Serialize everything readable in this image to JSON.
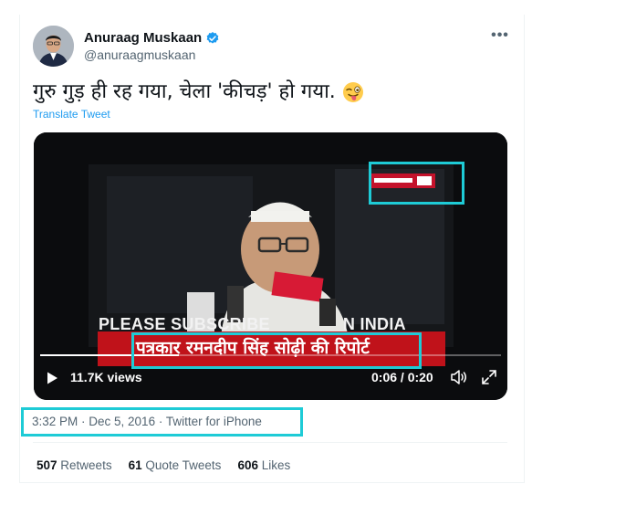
{
  "user": {
    "display_name": "Anuraag Muskaan",
    "handle": "@anuraagmuskaan",
    "verified": true
  },
  "tweet": {
    "text": "गुरु गुड़ ही रह गया, चेला 'कीचड़' हो गया.",
    "emoji": "winking-face-with-tongue",
    "translate_label": "Translate Tweet"
  },
  "video": {
    "overlay_subscribe_left": "PLEASE SUBSCRIBE",
    "overlay_subscribe_right": "N INDIA",
    "report_banner": "पत्रकार रमनदीप सिंह सोढ़ी की रिपोर्ट",
    "views": "11.7K views",
    "time": "0:06 / 0:20",
    "progress": 0.3
  },
  "meta": {
    "timestamp": "3:32 PM · Dec 5, 2016 · Twitter for iPhone"
  },
  "stats": {
    "retweets_count": "507",
    "retweets_label": "Retweets",
    "quotes_count": "61",
    "quotes_label": "Quote Tweets",
    "likes_count": "606",
    "likes_label": "Likes"
  },
  "colors": {
    "highlight": "#1ecbd6",
    "banner_red": "#c0121a",
    "link_blue": "#1d9bf0",
    "verified_blue": "#1d9bf0"
  }
}
